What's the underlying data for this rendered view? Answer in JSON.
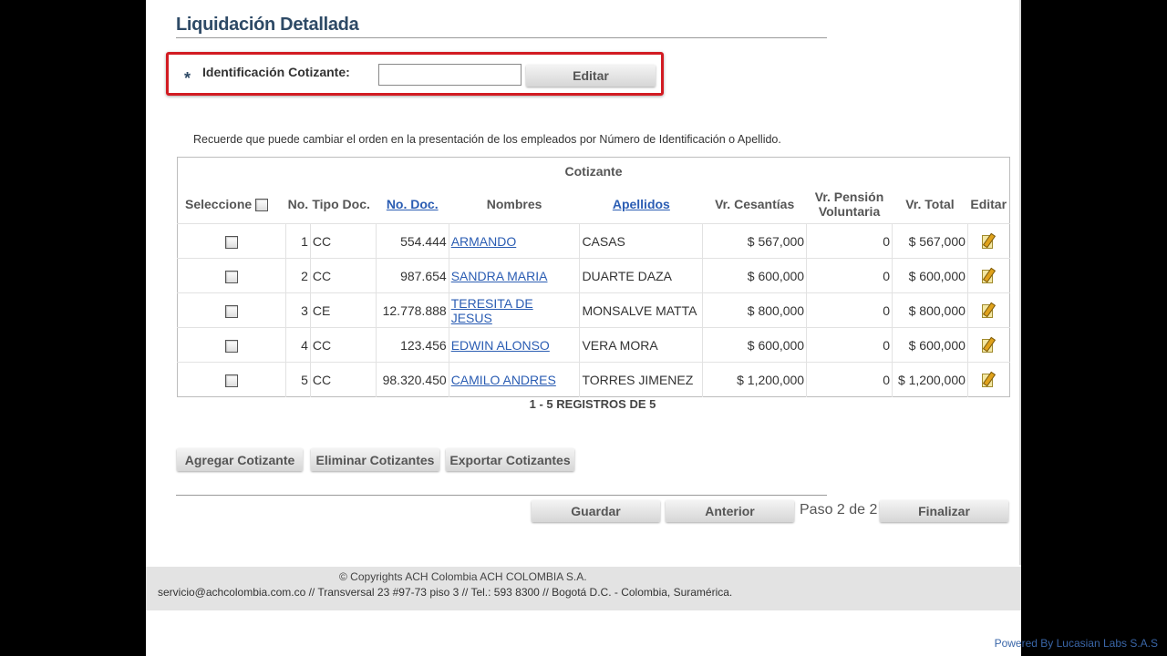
{
  "page": {
    "title": "Liquidación Detallada"
  },
  "id_search": {
    "required_mark": "*",
    "label": "Identificación Cotizante:",
    "value": "",
    "button_label": "Editar"
  },
  "hint": "Recuerde que puede cambiar el orden en la presentación de los empleados por Número de Identificación o Apellido.",
  "table": {
    "group_header": "Cotizante",
    "select_all_label": "Seleccione",
    "columns": {
      "no": "No.",
      "tipo_doc": "Tipo Doc.",
      "no_doc": "No. Doc.",
      "nombres": "Nombres",
      "apellidos": "Apellidos",
      "cesantias": "Vr. Cesantías",
      "pension": "Vr. Pensión Voluntaria",
      "total": "Vr. Total",
      "editar": "Editar"
    },
    "rows": [
      {
        "no": "1",
        "tipo_doc": "CC",
        "no_doc": "554.444",
        "nombres": "ARMANDO",
        "apellidos": "CASAS",
        "cesantias": "$ 567,000",
        "pension": "0",
        "total": "$ 567,000"
      },
      {
        "no": "2",
        "tipo_doc": "CC",
        "no_doc": "987.654",
        "nombres": "SANDRA MARIA",
        "apellidos": "DUARTE DAZA",
        "cesantias": "$ 600,000",
        "pension": "0",
        "total": "$ 600,000"
      },
      {
        "no": "3",
        "tipo_doc": "CE",
        "no_doc": "12.778.888",
        "nombres": "TERESITA DE JESUS",
        "apellidos": "MONSALVE MATTA",
        "cesantias": "$ 800,000",
        "pension": "0",
        "total": "$ 800,000"
      },
      {
        "no": "4",
        "tipo_doc": "CC",
        "no_doc": "123.456",
        "nombres": "EDWIN ALONSO",
        "apellidos": "VERA MORA",
        "cesantias": "$ 600,000",
        "pension": "0",
        "total": "$ 600,000"
      },
      {
        "no": "5",
        "tipo_doc": "CC",
        "no_doc": "98.320.450",
        "nombres": "CAMILO ANDRES",
        "apellidos": "TORRES JIMENEZ",
        "cesantias": "$ 1,200,000",
        "pension": "0",
        "total": "$ 1,200,000"
      }
    ],
    "records_text": "1 - 5 REGISTROS DE 5"
  },
  "actions": {
    "add": "Agregar Cotizante",
    "delete": "Eliminar Cotizantes",
    "export": "Exportar Cotizantes"
  },
  "wizard": {
    "save": "Guardar",
    "previous": "Anterior",
    "step": "Paso 2 de 2",
    "finish": "Finalizar"
  },
  "footer": {
    "copyright": "© Copyrights ACH Colombia ACH COLOMBIA S.A.",
    "address": "servicio@achcolombia.com.co // Transversal 23 #97-73 piso 3 // Tel.: 593 8300 // Bogotá D.C. - Colombia, Suramérica.",
    "powered_by": "Powered By Lucasian Labs S.A.S"
  },
  "icons": {
    "edit": "edit-icon"
  }
}
